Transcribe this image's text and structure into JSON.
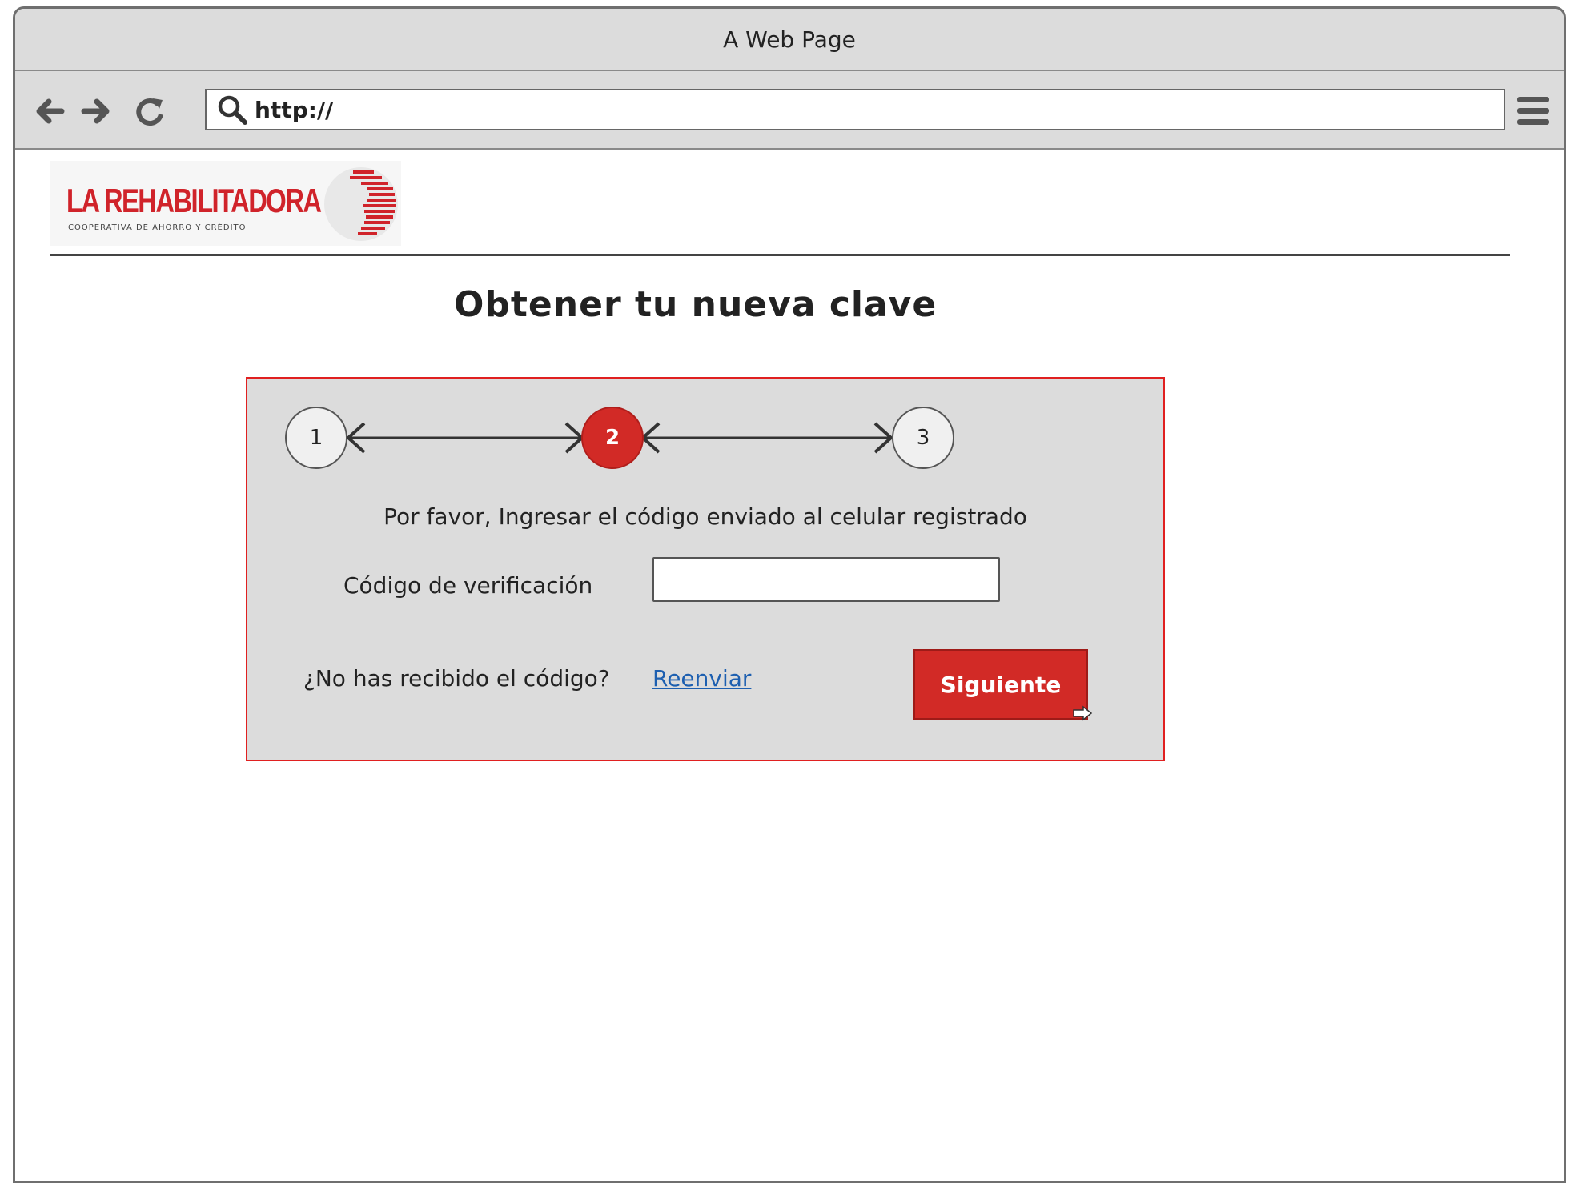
{
  "browser": {
    "title": "A Web Page",
    "url": "http://"
  },
  "logo": {
    "name": "LA REHABILITADORA",
    "tagline": "COOPERATIVA DE AHORRO Y CRÉDITO",
    "brand_color": "#d0232a"
  },
  "page": {
    "title": "Obtener tu nueva clave"
  },
  "stepper": {
    "steps": [
      "1",
      "2",
      "3"
    ],
    "current_step": 2,
    "active_color": "#d22a26"
  },
  "form": {
    "instruction": "Por favor, Ingresar el código enviado al celular registrado",
    "code_label": "Código de verificación",
    "code_value": "",
    "resend_question": "¿No has recibido el código?",
    "resend_link": "Reenviar",
    "next_button": "Siguiente"
  },
  "colors": {
    "card_border": "#e02020",
    "card_bg": "#dcdcdc",
    "link": "#1d5fb0"
  }
}
